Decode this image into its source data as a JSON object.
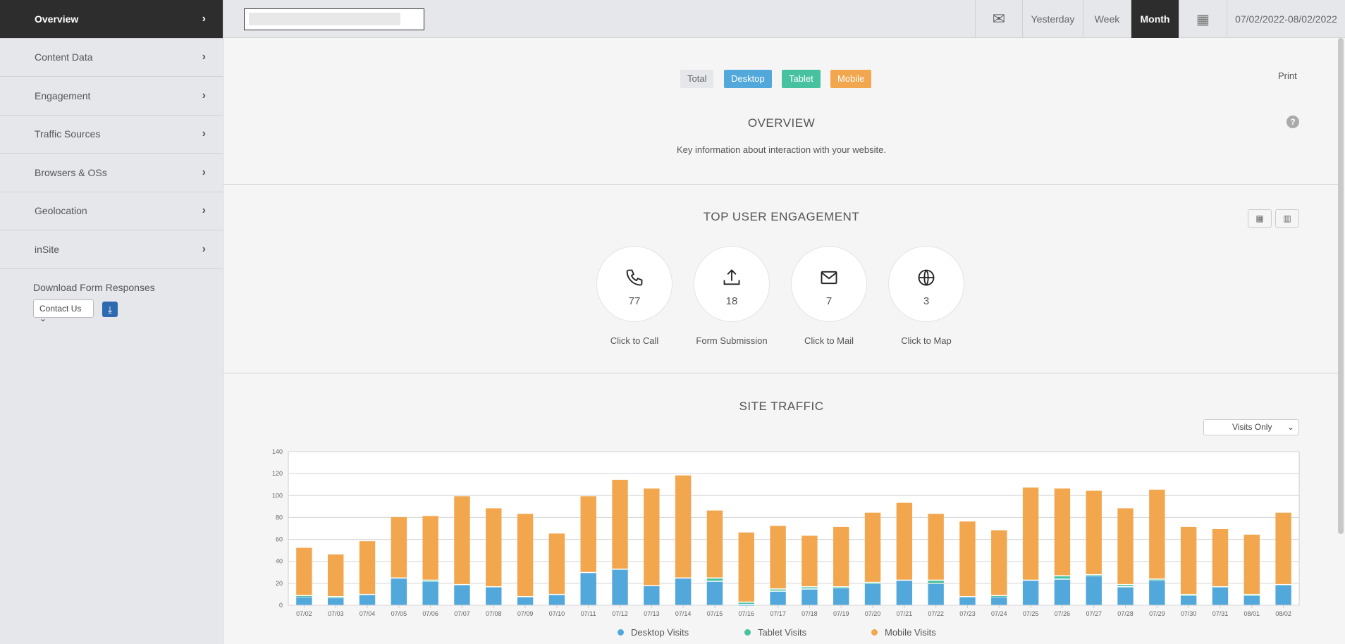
{
  "sidebar": {
    "items": [
      {
        "label": "Overview"
      },
      {
        "label": "Content Data"
      },
      {
        "label": "Engagement"
      },
      {
        "label": "Traffic Sources"
      },
      {
        "label": "Browsers & OSs"
      },
      {
        "label": "Geolocation"
      },
      {
        "label": "inSite"
      }
    ],
    "download_label": "Download Form Responses",
    "form_select": "Contact Us"
  },
  "topbar": {
    "yesterday": "Yesterday",
    "week": "Week",
    "month": "Month",
    "date_range": "07/02/2022-08/02/2022"
  },
  "filters": {
    "total": "Total",
    "desktop": "Desktop",
    "tablet": "Tablet",
    "mobile": "Mobile",
    "print": "Print"
  },
  "overview": {
    "title": "OVERVIEW",
    "subtitle": "Key information about interaction with your website."
  },
  "engagement": {
    "title": "TOP USER ENGAGEMENT",
    "items": [
      {
        "value": "77",
        "label": "Click to Call"
      },
      {
        "value": "18",
        "label": "Form Submission"
      },
      {
        "value": "7",
        "label": "Click to Mail"
      },
      {
        "value": "3",
        "label": "Click to Map"
      }
    ]
  },
  "traffic": {
    "title": "SITE TRAFFIC",
    "select": "Visits Only"
  },
  "colors": {
    "desktop": "#53a8db",
    "tablet": "#47c2a0",
    "mobile": "#f2a74f",
    "dark": "#2d2d2d"
  },
  "chart_data": {
    "type": "bar",
    "stacked": true,
    "ylim": [
      0,
      140
    ],
    "yticks": [
      0,
      20,
      40,
      60,
      80,
      100,
      120,
      140
    ],
    "categories": [
      "07/02",
      "07/03",
      "07/04",
      "07/05",
      "07/06",
      "07/07",
      "07/08",
      "07/09",
      "07/10",
      "07/11",
      "07/12",
      "07/13",
      "07/14",
      "07/15",
      "07/16",
      "07/17",
      "07/18",
      "07/19",
      "07/20",
      "07/21",
      "07/22",
      "07/23",
      "07/24",
      "07/25",
      "07/26",
      "07/27",
      "07/28",
      "07/29",
      "07/30",
      "07/31",
      "08/01",
      "08/02"
    ],
    "series": [
      {
        "name": "Desktop Visits",
        "values": [
          8,
          7,
          10,
          25,
          22,
          19,
          17,
          8,
          10,
          30,
          33,
          18,
          25,
          22,
          1,
          13,
          15,
          16,
          20,
          23,
          20,
          8,
          8,
          23,
          24,
          27,
          17,
          23,
          9,
          17,
          9,
          19
        ]
      },
      {
        "name": "Tablet Visits",
        "values": [
          1,
          1,
          0,
          0,
          1,
          0,
          0,
          0,
          0,
          0,
          0,
          0,
          0,
          3,
          2,
          2,
          2,
          1,
          1,
          0,
          3,
          0,
          1,
          0,
          3,
          1,
          2,
          1,
          1,
          0,
          1,
          0
        ]
      },
      {
        "name": "Mobile Visits",
        "values": [
          44,
          39,
          49,
          56,
          59,
          81,
          72,
          76,
          56,
          70,
          82,
          89,
          94,
          62,
          64,
          58,
          47,
          55,
          64,
          71,
          61,
          69,
          60,
          85,
          80,
          77,
          70,
          82,
          62,
          53,
          55,
          66
        ]
      }
    ],
    "legend_position": "bottom"
  }
}
